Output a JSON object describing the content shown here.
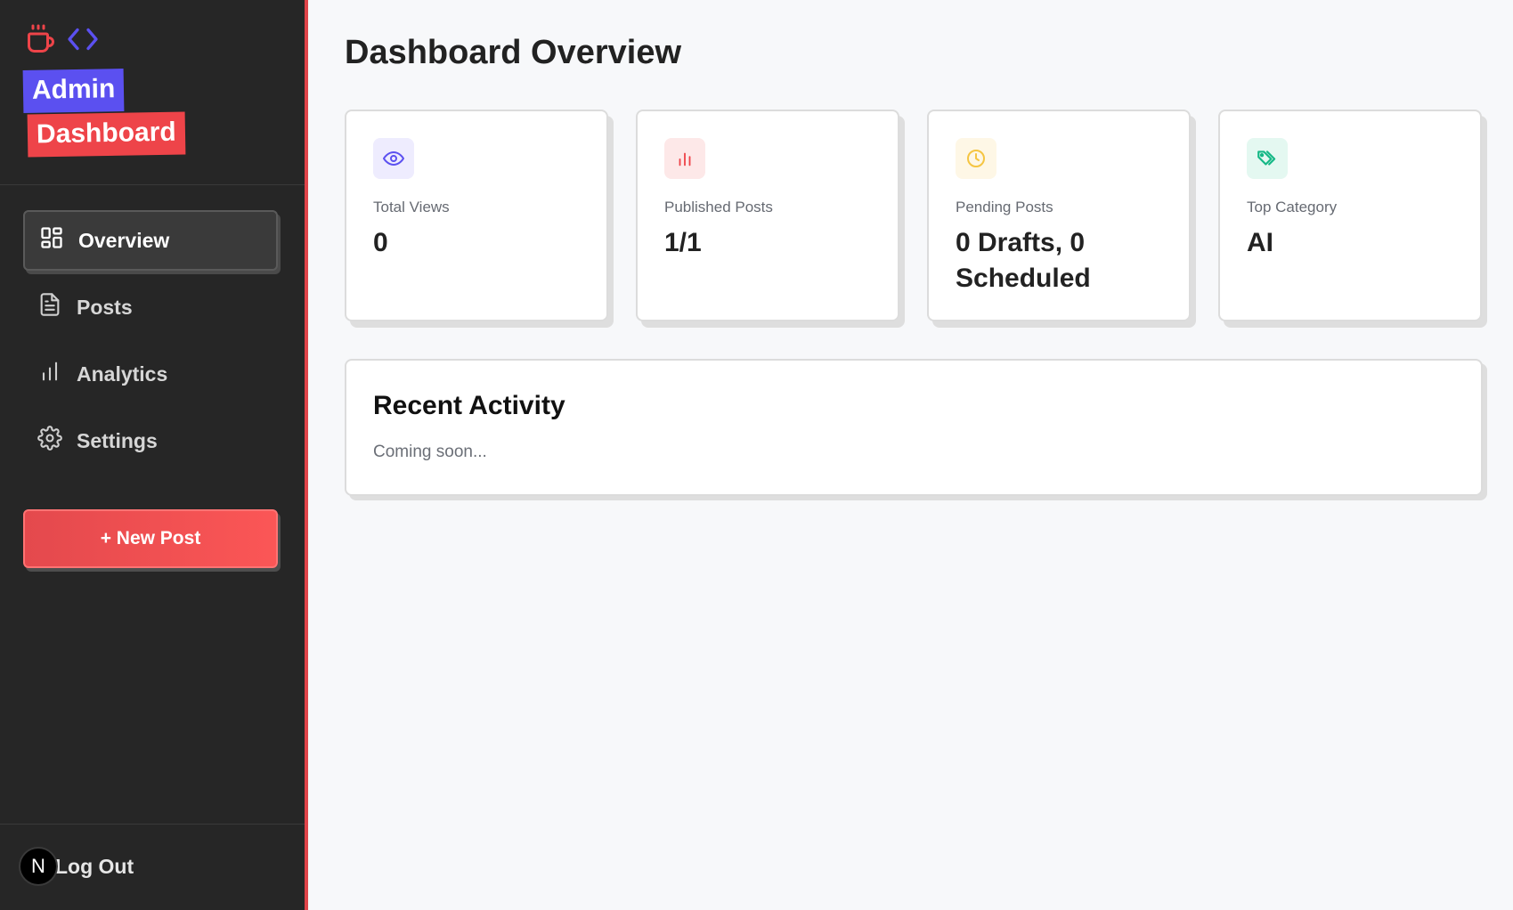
{
  "sidebar": {
    "logo_icons": [
      "coffee-cup-icon",
      "code-brackets-icon"
    ],
    "badge_admin": "Admin",
    "badge_dashboard": "Dashboard",
    "nav": [
      {
        "label": "Overview",
        "icon": "layout-grid-icon",
        "active": true
      },
      {
        "label": "Posts",
        "icon": "document-icon",
        "active": false
      },
      {
        "label": "Analytics",
        "icon": "bar-chart-icon",
        "active": false
      },
      {
        "label": "Settings",
        "icon": "gear-icon",
        "active": false
      }
    ],
    "new_post_label": "+ New Post",
    "logout_label": "Log Out",
    "avatar_letter": "N"
  },
  "main": {
    "title": "Dashboard Overview",
    "stats": [
      {
        "label": "Total Views",
        "value": "0",
        "icon": "eye-icon",
        "color": "#5b50f0",
        "bg": "#eeecfe"
      },
      {
        "label": "Published Posts",
        "value": "1/1",
        "icon": "bar-chart-icon",
        "color": "#ee4449",
        "bg": "#fde8e8"
      },
      {
        "label": "Pending Posts",
        "value": "0 Drafts, 0 Scheduled",
        "icon": "clock-icon",
        "color": "#f5c542",
        "bg": "#fef7e6"
      },
      {
        "label": "Top Category",
        "value": "AI",
        "icon": "tags-icon",
        "color": "#15b886",
        "bg": "#e4f8f1"
      }
    ],
    "activity": {
      "title": "Recent Activity",
      "text": "Coming soon..."
    }
  },
  "colors": {
    "sidebar_bg": "#262626",
    "accent_red": "#ee4449",
    "accent_purple": "#5b50f0",
    "page_bg": "#f7f8fa"
  }
}
